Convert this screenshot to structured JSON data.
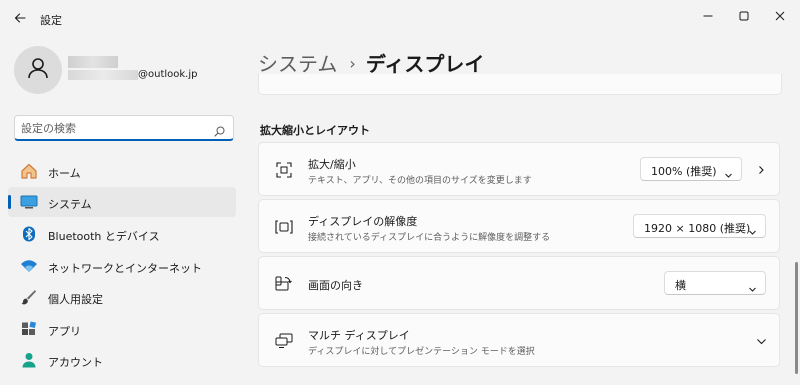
{
  "window": {
    "title": "設定",
    "icons": {
      "back": "arrow-left-icon",
      "minimize": "minimize-icon",
      "maximize": "maximize-icon",
      "close": "close-icon"
    }
  },
  "account": {
    "email_suffix": "@outlook.jp"
  },
  "search": {
    "placeholder": "設定の検索",
    "value": ""
  },
  "nav": {
    "items": [
      {
        "label": "ホーム",
        "icon": "home-icon",
        "selected": false
      },
      {
        "label": "システム",
        "icon": "monitor-icon",
        "selected": true
      },
      {
        "label": "Bluetooth とデバイス",
        "icon": "bluetooth-icon",
        "selected": false
      },
      {
        "label": "ネットワークとインターネット",
        "icon": "wifi-icon",
        "selected": false
      },
      {
        "label": "個人用設定",
        "icon": "brush-icon",
        "selected": false
      },
      {
        "label": "アプリ",
        "icon": "apps-icon",
        "selected": false
      },
      {
        "label": "アカウント",
        "icon": "person-icon",
        "selected": false
      }
    ]
  },
  "main": {
    "breadcrumb": {
      "parent": "システム",
      "separator": "›",
      "current": "ディスプレイ"
    },
    "section_title": "拡大縮小とレイアウト",
    "cards": [
      {
        "title": "拡大/縮小",
        "subtitle": "テキスト、アプリ、その他の項目のサイズを変更します",
        "value": "100% (推奨)",
        "icon": "scale-icon"
      },
      {
        "title": "ディスプレイの解像度",
        "subtitle": "接続されているディスプレイに合うように解像度を調整する",
        "value": "1920 × 1080 (推奨)",
        "icon": "resolution-icon"
      },
      {
        "title": "画面の向き",
        "subtitle": "",
        "value": "横",
        "icon": "orientation-icon"
      },
      {
        "title": "マルチ ディスプレイ",
        "subtitle": "ディスプレイに対してプレゼンテーション モードを選択",
        "value": "",
        "icon": "multi-display-icon"
      }
    ]
  },
  "colors": {
    "accent": "#005fb8",
    "background": "#f3f3f3",
    "card": "#fbfbfb"
  }
}
